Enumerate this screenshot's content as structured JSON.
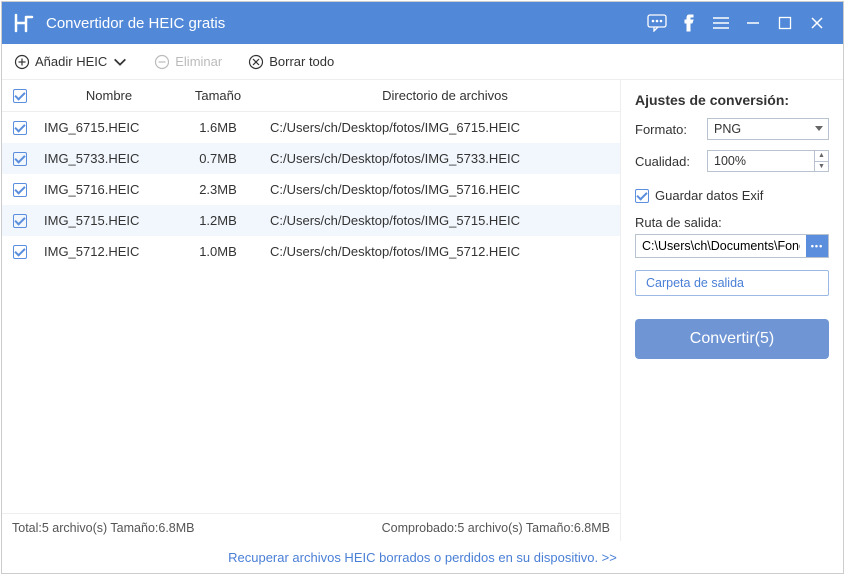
{
  "titlebar": {
    "title": "Convertidor de HEIC gratis"
  },
  "toolbar": {
    "add": "Añadir HEIC",
    "remove": "Eliminar",
    "clear": "Borrar todo"
  },
  "table": {
    "headers": {
      "name": "Nombre",
      "size": "Tamaño",
      "dir": "Directorio de archivos"
    },
    "rows": [
      {
        "checked": true,
        "name": "IMG_6715.HEIC",
        "size": "1.6MB",
        "dir": "C:/Users/ch/Desktop/fotos/IMG_6715.HEIC"
      },
      {
        "checked": true,
        "name": "IMG_5733.HEIC",
        "size": "0.7MB",
        "dir": "C:/Users/ch/Desktop/fotos/IMG_5733.HEIC"
      },
      {
        "checked": true,
        "name": "IMG_5716.HEIC",
        "size": "2.3MB",
        "dir": "C:/Users/ch/Desktop/fotos/IMG_5716.HEIC"
      },
      {
        "checked": true,
        "name": "IMG_5715.HEIC",
        "size": "1.2MB",
        "dir": "C:/Users/ch/Desktop/fotos/IMG_5715.HEIC"
      },
      {
        "checked": true,
        "name": "IMG_5712.HEIC",
        "size": "1.0MB",
        "dir": "C:/Users/ch/Desktop/fotos/IMG_5712.HEIC"
      }
    ]
  },
  "status": {
    "left": "Total:5 archivo(s) Tamaño:6.8MB",
    "right": "Comprobado:5 archivo(s) Tamaño:6.8MB"
  },
  "footer": {
    "link": "Recuperar archivos HEIC borrados o perdidos en su dispositivo. >>"
  },
  "settings": {
    "heading": "Ajustes de conversión:",
    "format_label": "Formato:",
    "format_value": "PNG",
    "quality_label": "Cualidad:",
    "quality_value": "100%",
    "exif_label": "Guardar datos Exif",
    "output_label": "Ruta de salida:",
    "output_path": "C:\\Users\\ch\\Documents\\FonePaw",
    "open_folder": "Carpeta de salida",
    "convert": "Convertir(5)"
  }
}
